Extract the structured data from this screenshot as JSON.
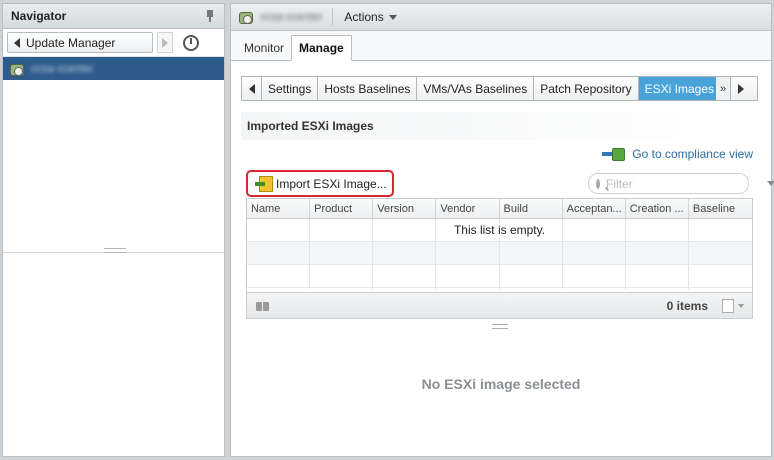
{
  "navigator": {
    "title": "Navigator",
    "back_label": "Update Manager",
    "selected_item": "vcsa-vcenter"
  },
  "header": {
    "object_name": "vcsa-vcenter",
    "actions_label": "Actions"
  },
  "subtabs": [
    {
      "label": "Monitor",
      "active": false
    },
    {
      "label": "Manage",
      "active": true
    }
  ],
  "tabstrip": {
    "tabs": [
      {
        "label": "Settings",
        "active": false
      },
      {
        "label": "Hosts Baselines",
        "active": false
      },
      {
        "label": "VMs/VAs Baselines",
        "active": false
      },
      {
        "label": "Patch Repository",
        "active": false
      },
      {
        "label": "ESXi Images",
        "active": true
      }
    ],
    "more_symbol": "»"
  },
  "section": {
    "title": "Imported ESXi Images",
    "compliance_link": "Go to compliance view",
    "import_button": "Import ESXi Image...",
    "filter_placeholder": "Filter"
  },
  "grid": {
    "columns": [
      "Name",
      "Product",
      "Version",
      "Vendor",
      "Build",
      "Acceptan...",
      "Creation ...",
      "Baseline"
    ],
    "empty_message": "This list is empty.",
    "items_count": "0 items"
  },
  "details": {
    "empty_message": "No ESXi image selected"
  },
  "colors": {
    "selection": "#2d5b8c",
    "active_tab": "#4aa3d8",
    "link": "#2d6ca2",
    "highlight_outline": "#d8262e"
  },
  "icons": [
    "pin-icon",
    "back-arrow-icon",
    "forward-arrow-icon",
    "history-icon",
    "vcenter-icon",
    "chevron-down-icon",
    "compliance-icon",
    "import-icon",
    "search-icon",
    "binoculars-icon",
    "export-icon"
  ]
}
